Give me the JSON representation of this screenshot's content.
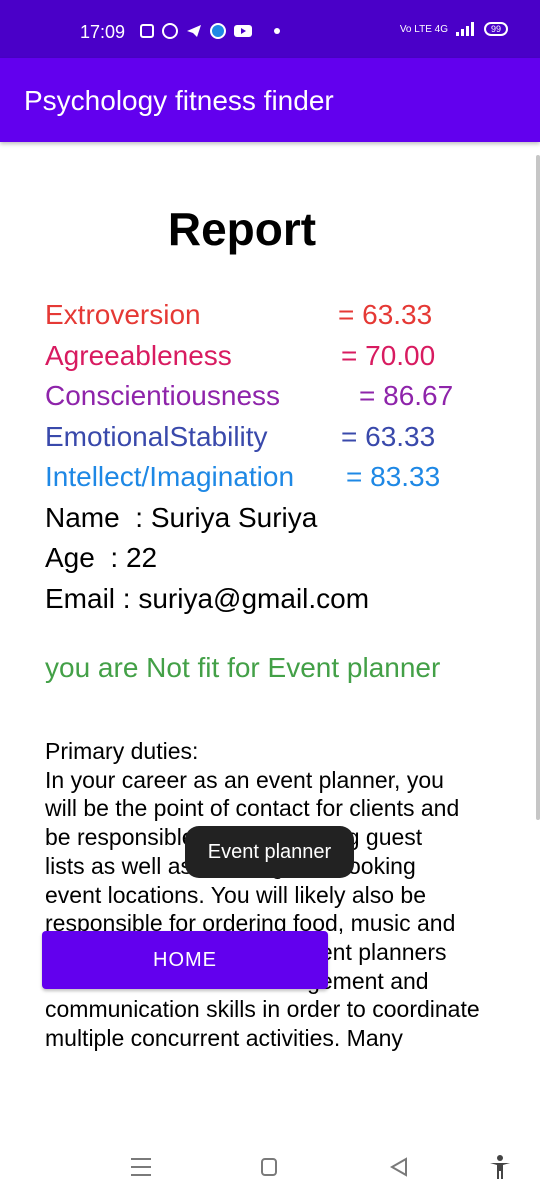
{
  "status_bar": {
    "time": "17:09",
    "network": "Vo LTE 4G",
    "battery": "99"
  },
  "app_bar": {
    "title": "Psychology fitness finder"
  },
  "report": {
    "title": "Report",
    "scores": [
      {
        "label": "Extroversion",
        "value": "= 63.33",
        "color": "#e53935"
      },
      {
        "label": "Agreeableness",
        "value": "= 70.00",
        "color": "#d81b60"
      },
      {
        "label": "Conscientiousness",
        "value": "= 86.67",
        "color": "#8e24aa"
      },
      {
        "label": "EmotionalStability",
        "value": "= 63.33",
        "color": "#3949ab"
      },
      {
        "label": "Intellect/Imagination",
        "value": "= 83.33",
        "color": "#1e88e5"
      }
    ],
    "name": {
      "label": "Name  : ",
      "value": "Suriya Suriya"
    },
    "age": {
      "label": "Age  : ",
      "value": "22"
    },
    "email": {
      "label": "Email : ",
      "value": "suriya@gmail.com"
    },
    "fit_status": "you are Not fit for Event planner",
    "fit_status_color": "#43a047",
    "duties_heading": "Primary duties:",
    "duties_text": " In your career as an event planner, you\nwill be the point of contact for clients and\nbe responsible for coordinating guest\nlists as well as scouting and booking\nevent locations. You will likely also be\nresponsible for ordering food, music and\naudio/visual equipment. Event planners\nneed excellent time management and\ncommunication skills in order to coordinate\nmultiple concurrent activities. Many"
  },
  "toast": "Event planner",
  "home_button": "HOME",
  "colors": {
    "accent": "#6200ee",
    "status_bar": "#4a00c8"
  },
  "icons": [
    "news-icon",
    "whatsapp-icon",
    "telegram-icon",
    "signal-icon",
    "youtube-icon",
    "wifi-icon",
    "signal-strength-icon",
    "battery-icon",
    "menu-icon",
    "home-icon",
    "back-icon",
    "accessibility-icon"
  ]
}
